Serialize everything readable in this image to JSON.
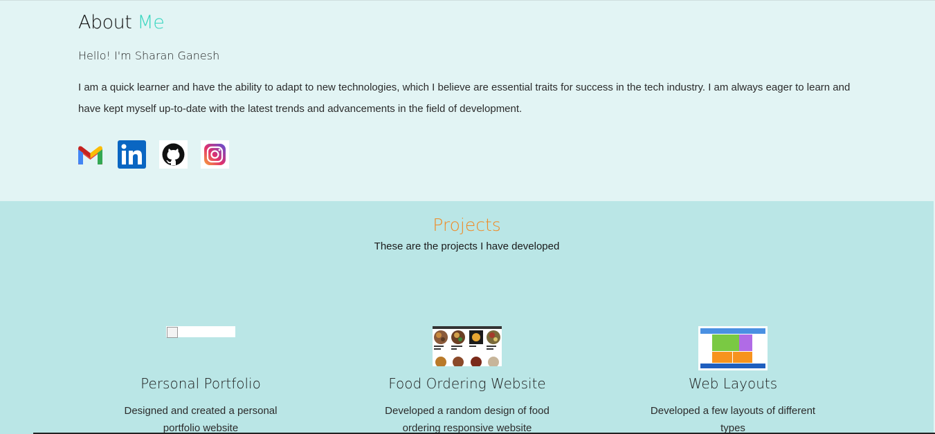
{
  "about": {
    "title_main": "About",
    "title_accent": "Me",
    "greeting": "Hello! I'm Sharan Ganesh",
    "bio": "I am a quick learner and have the ability to adapt to new technologies, which I believe are essential traits for success in the tech industry. I am always eager to learn and have kept myself up-to-date with the latest trends and advancements in the field of development.",
    "socials": [
      {
        "name": "gmail-icon"
      },
      {
        "name": "linkedin-icon"
      },
      {
        "name": "github-icon"
      },
      {
        "name": "instagram-icon"
      }
    ]
  },
  "projects": {
    "title": "Projects",
    "subtitle": "These are the projects I have developed",
    "items": [
      {
        "name": "Personal Portfolio",
        "desc": "Designed and created a personal portfolio website"
      },
      {
        "name": "Food Ordering Website",
        "desc": "Developed a random design of food ordering responsive website"
      },
      {
        "name": "Web Layouts",
        "desc": "Developed a few layouts of different types"
      }
    ]
  },
  "colors": {
    "accent_teal": "#3ad6c0",
    "accent_orange": "#f08a24",
    "about_bg": "#e2f4f4",
    "projects_bg": "#bae6e6"
  }
}
